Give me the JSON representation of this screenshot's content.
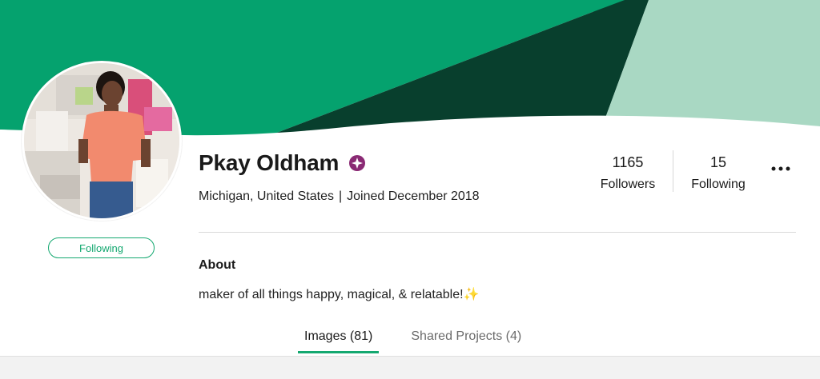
{
  "profile": {
    "name": "Pkay Oldham",
    "badge_icon": "verified-star-icon",
    "location": "Michigan, United States",
    "separator": "|",
    "joined": "Joined December 2018",
    "follow_button_label": "Following"
  },
  "stats": {
    "followers_count": "1165",
    "followers_label": "Followers",
    "following_count": "15",
    "following_label": "Following"
  },
  "more_menu": {
    "icon": "more-horizontal-icon"
  },
  "about": {
    "title": "About",
    "text": "maker of all things happy, magical, & relatable!",
    "emoji": "✨"
  },
  "tabs": [
    {
      "label": "Images (81)",
      "active": true
    },
    {
      "label": "Shared Projects (4)",
      "active": false
    }
  ],
  "colors": {
    "brand_green": "#14a870",
    "banner_dark": "#073e2c",
    "banner_light": "#a8d7c2",
    "badge_purple": "#8a2a74"
  }
}
